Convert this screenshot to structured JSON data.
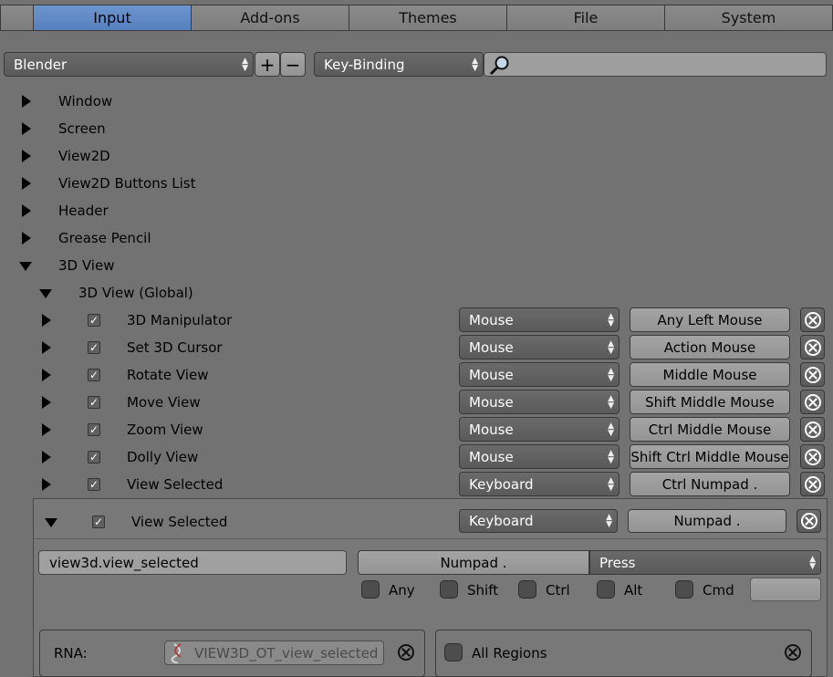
{
  "tabs": [
    "Input",
    "Add-ons",
    "Themes",
    "File",
    "System"
  ],
  "active_tab": "Input",
  "toolbar": {
    "preset": "Blender",
    "add_symbol": "+",
    "remove_symbol": "−",
    "filter_mode": "Key-Binding",
    "search_value": ""
  },
  "tree": [
    {
      "label": "Window",
      "expanded": false
    },
    {
      "label": "Screen",
      "expanded": false
    },
    {
      "label": "View2D",
      "expanded": false
    },
    {
      "label": "View2D Buttons List",
      "expanded": false
    },
    {
      "label": "Header",
      "expanded": false
    },
    {
      "label": "Grease Pencil",
      "expanded": false
    },
    {
      "label": "3D View",
      "expanded": true
    }
  ],
  "subtree": {
    "label": "3D View (Global)"
  },
  "keymap_items": [
    {
      "name": "3D Manipulator",
      "type": "Mouse",
      "event": "Any Left Mouse"
    },
    {
      "name": "Set 3D Cursor",
      "type": "Mouse",
      "event": "Action Mouse"
    },
    {
      "name": "Rotate View",
      "type": "Mouse",
      "event": "Middle Mouse"
    },
    {
      "name": "Move View",
      "type": "Mouse",
      "event": "Shift Middle Mouse"
    },
    {
      "name": "Zoom View",
      "type": "Mouse",
      "event": "Ctrl Middle Mouse"
    },
    {
      "name": "Dolly View",
      "type": "Mouse",
      "event": "Shift Ctrl Middle Mouse"
    },
    {
      "name": "View Selected",
      "type": "Keyboard",
      "event": "Ctrl Numpad ."
    }
  ],
  "expanded_item": {
    "name": "View Selected",
    "type": "Keyboard",
    "event": "Numpad .",
    "operator": "view3d.view_selected",
    "key": "Numpad .",
    "value": "Press",
    "modifiers": [
      "Any",
      "Shift",
      "Ctrl",
      "Alt",
      "Cmd"
    ],
    "key_modifier": "",
    "rna_label": "RNA:",
    "rna_value": "VIEW3D_OT_view_selected",
    "regions_label": "All Regions"
  },
  "colors": {
    "background": "#727272",
    "active_tab": "#5f8ac7",
    "dropdown": "#626262",
    "button": "#9c9c9c"
  }
}
